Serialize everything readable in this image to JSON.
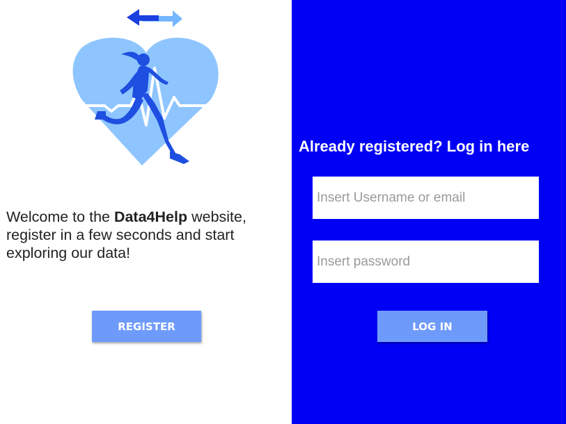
{
  "welcome": {
    "prefix": "Welcome to the ",
    "brand": "Data4Help",
    "suffix": " website, register in a few seconds and start exploring our data!"
  },
  "register_label": "REGISTER",
  "login": {
    "title": "Already registered? Log in here",
    "username_placeholder": "Insert Username or email",
    "password_placeholder": "Insert password",
    "button_label": "LOG IN"
  },
  "icons": {
    "logo": "heart-runner-logo-icon",
    "arrows": "left-right-arrows-icon"
  },
  "colors": {
    "login_panel_bg": "#0000f5",
    "button_bg": "#6e9bfb",
    "heart_fill": "#8ec5ff",
    "runner_fill": "#1f4fe0",
    "arrow_dark": "#1b3fe0",
    "arrow_light": "#74b6ff"
  }
}
